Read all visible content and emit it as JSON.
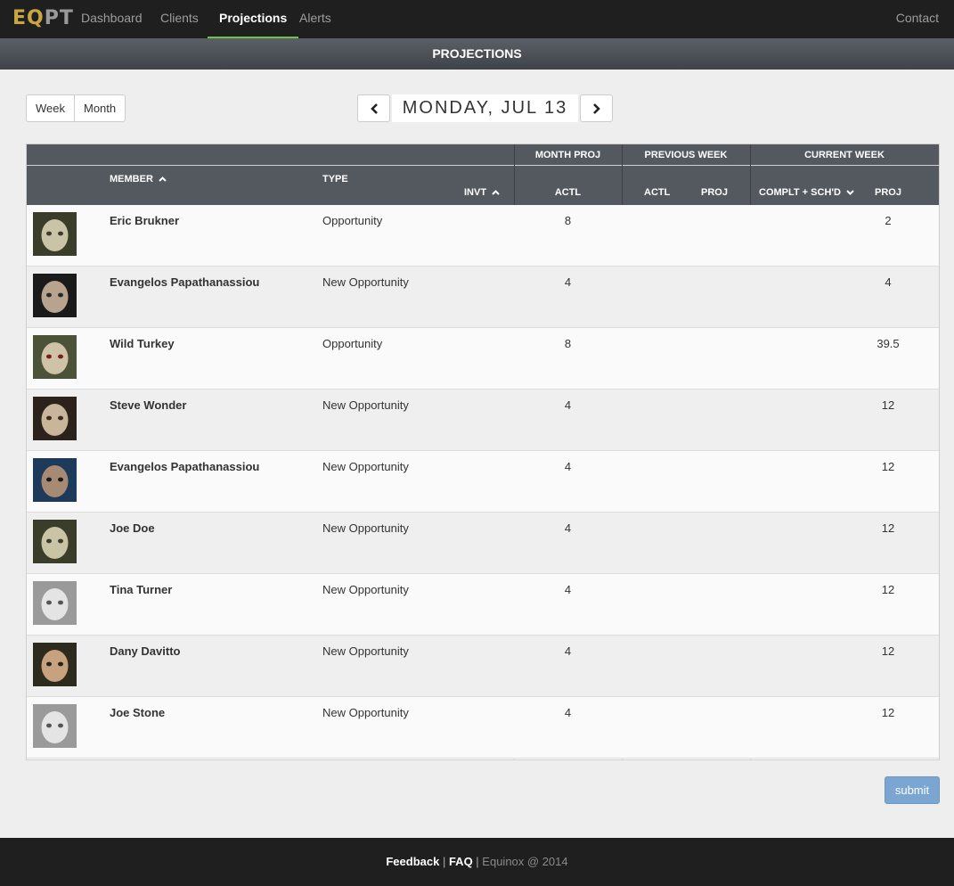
{
  "navbar": {
    "logo_part1": "EQ",
    "logo_part2": "PT",
    "items": [
      {
        "label": "Dashboard"
      },
      {
        "label": "Clients"
      },
      {
        "label": "Projections"
      },
      {
        "label": "Alerts"
      }
    ],
    "contact": "Contact",
    "active_color": "#6cc24a",
    "logo_color": "#c9a640"
  },
  "page_title": "PROJECTIONS",
  "controls": {
    "week_label": "Week",
    "month_label": "Month",
    "date": "MONDAY, JUL 13",
    "prev_icon": "chevron-left-icon",
    "next_icon": "chevron-right-icon"
  },
  "table": {
    "group_headers": {
      "month_proj": "MONTH PROJ",
      "previous_week": "PREVIOUS WEEK",
      "current_week": "CURRENT WEEK"
    },
    "columns": {
      "member": "MEMBER",
      "type": "TYPE",
      "invt": "INVT",
      "month_actl": "ACTL",
      "prev_actl": "ACTL",
      "prev_proj": "PROJ",
      "compl_schd": "COMPLT + SCH'D",
      "cur_proj": "PROJ"
    },
    "rows": [
      {
        "member": "Eric Brukner",
        "type": "Opportunity",
        "month_actl": "8",
        "cur_proj": "2",
        "avatar": "doll-face"
      },
      {
        "member": "Evangelos Papathanassiou",
        "type": "New Opportunity",
        "month_actl": "4",
        "cur_proj": "4",
        "avatar": "old-man-portrait"
      },
      {
        "member": "Wild Turkey",
        "type": "Opportunity",
        "month_actl": "8",
        "cur_proj": "39.5",
        "avatar": "painted-doll-face"
      },
      {
        "member": "Steve Wonder",
        "type": "New Opportunity",
        "month_actl": "4",
        "cur_proj": "12",
        "avatar": "bearded-man-portrait"
      },
      {
        "member": "Evangelos Papathanassiou",
        "type": "New Opportunity",
        "month_actl": "4",
        "cur_proj": "12",
        "avatar": "man-portrait-blue"
      },
      {
        "member": "Joe Doe",
        "type": "New Opportunity",
        "month_actl": "4",
        "cur_proj": "12",
        "avatar": "doll-face"
      },
      {
        "member": "Tina Turner",
        "type": "New Opportunity",
        "month_actl": "4",
        "cur_proj": "12",
        "avatar": "child-photo"
      },
      {
        "member": "Dany Davitto",
        "type": "New Opportunity",
        "month_actl": "4",
        "cur_proj": "12",
        "avatar": "smiling-man-photo"
      },
      {
        "member": "Joe Stone",
        "type": "New Opportunity",
        "month_actl": "4",
        "cur_proj": "12",
        "avatar": "child-photo"
      }
    ]
  },
  "submit_label": "submit",
  "footer": {
    "feedback": "Feedback",
    "sep1": " | ",
    "faq": "FAQ",
    "sep2": " | ",
    "copyright": "Equinox @ 2014"
  }
}
